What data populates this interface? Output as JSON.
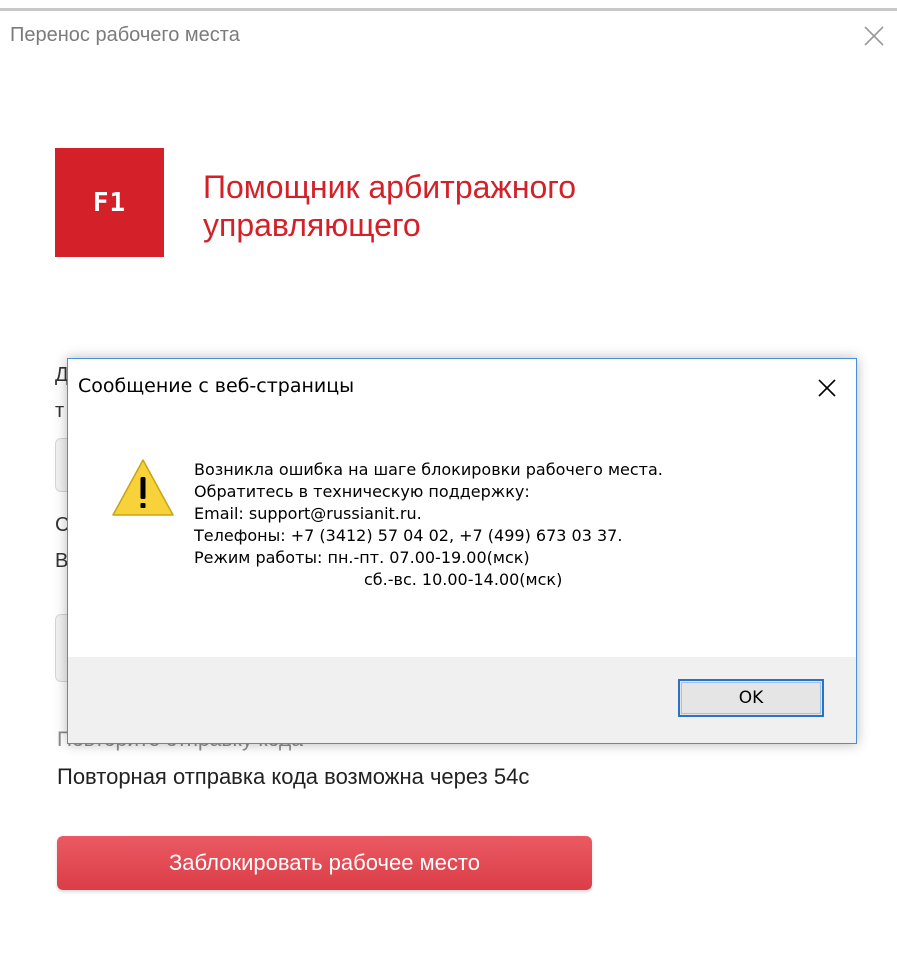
{
  "window": {
    "title": "Перенос рабочего места"
  },
  "app": {
    "logo_text": "F1",
    "title": "Помощник арбитражного управляющего",
    "brand_color": "#d32029"
  },
  "background": {
    "fragments": [
      "Д",
      "т",
      "С",
      "В"
    ]
  },
  "resend": {
    "link_label": "Повторите отправку кода",
    "timer_text": "Повторная отправка кода возможна через 54с"
  },
  "primary_button": {
    "label": "Заблокировать рабочее место"
  },
  "dialog": {
    "title": "Сообщение с веб-страницы",
    "icon": "warning-icon",
    "message_lines": [
      "Возникла ошибка на шаге блокировки рабочего места.",
      "Обратитесь в техническую поддержку:",
      "Email: support@russianit.ru.",
      "Телефоны: +7 (3412) 57 04 02, +7 (499) 673 03 37.",
      "Режим работы: пн.-пт. 07.00-19.00(мск)",
      "сб.-вс. 10.00-14.00(мск)"
    ],
    "ok_label": "OK"
  }
}
